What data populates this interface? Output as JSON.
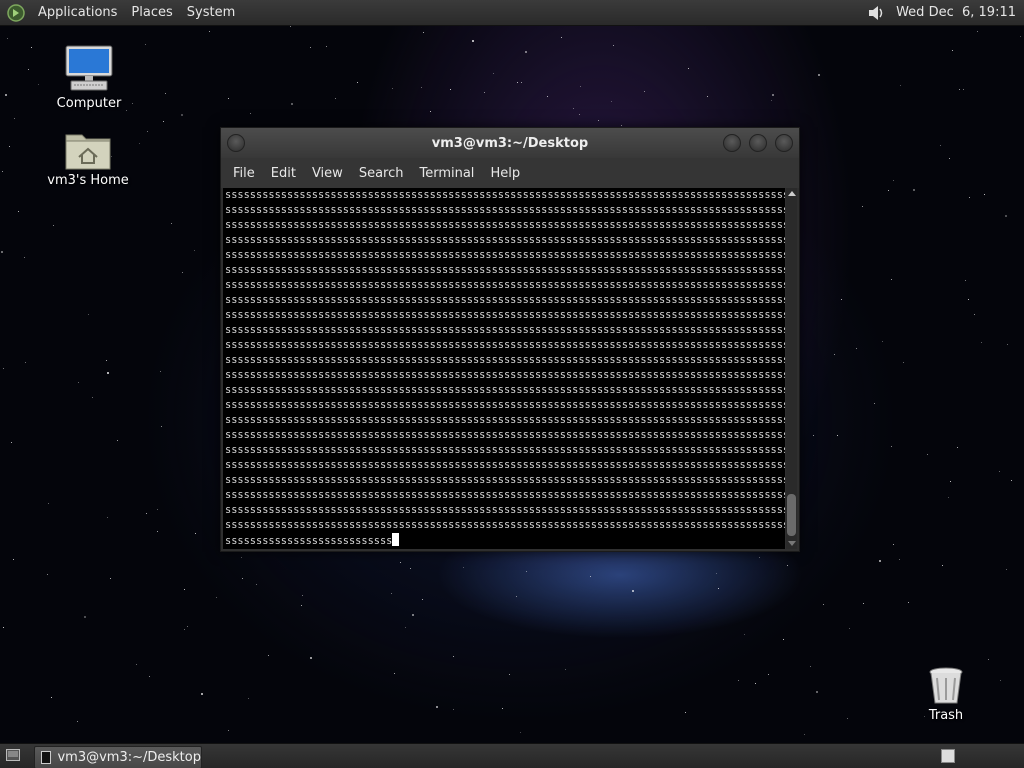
{
  "top_panel": {
    "menus": [
      "Applications",
      "Places",
      "System"
    ],
    "clock": "Wed Dec  6, 19:11"
  },
  "desktop": {
    "icons": [
      {
        "label": "Computer"
      },
      {
        "label": "vm3's Home"
      },
      {
        "label": "Trash"
      }
    ]
  },
  "terminal": {
    "title": "vm3@vm3:~/Desktop",
    "menus": [
      "File",
      "Edit",
      "View",
      "Search",
      "Terminal",
      "Help"
    ],
    "full_line": "ssssssssssssssssssssssssssssssssssssssssssssssssssssssssssssssssssssssssssssssssssssssssssss",
    "full_line_count": 23,
    "last_line": "sssssssssssssssssssssssssss"
  },
  "taskbar": {
    "window_button": "vm3@vm3:~/Desktop"
  },
  "colors": {
    "panel": "#2f2f2f",
    "terminal_bg": "#000000",
    "terminal_fg": "#d8d8d8"
  }
}
